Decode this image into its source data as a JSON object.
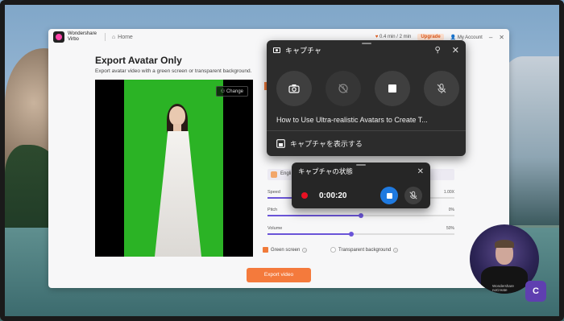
{
  "app": {
    "brand_line1": "Wondershare",
    "brand_line2": "Virbo",
    "home": "Home",
    "time": "0.4 min / 2 min",
    "upgrade": "Upgrade",
    "account": "My Account",
    "heading": "Export Avatar Only",
    "subheading": "Export avatar video with a green screen or transparent background.",
    "change": "Change",
    "language": "Engli",
    "speed_label": "Speed",
    "speed_value": "1.00X",
    "speed_level": 0.5,
    "pitch_label": "Pitch",
    "pitch_value": "0%",
    "pitch_level": 0.5,
    "volume_label": "Volume",
    "volume_value": "50%",
    "volume_level": 0.45,
    "green_screen": "Green screen",
    "transparent_bg": "Transparent background",
    "export_btn": "Export video"
  },
  "capture": {
    "title": "キャプチャ",
    "video_title": "How to Use Ultra-realistic Avatars to Create T...",
    "show_label": "キャプチャを表示する",
    "icons": [
      "camera-icon",
      "history-off-icon",
      "stop-icon",
      "mic-off-icon"
    ]
  },
  "status": {
    "title": "キャプチャの状態",
    "timer": "0:00:20"
  },
  "webcam": {
    "caption1": "Wondershare",
    "caption2": "noCreate"
  }
}
